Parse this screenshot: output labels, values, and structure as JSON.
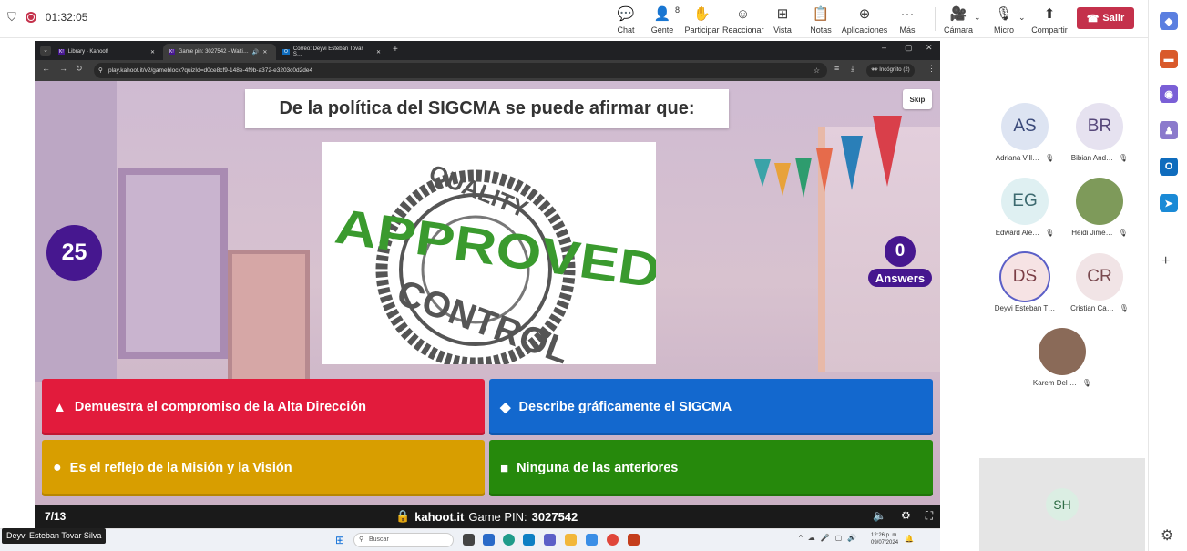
{
  "meeting": {
    "timer": "01:32:05",
    "tools": [
      {
        "label": "Chat",
        "icon": "chat-icon",
        "glyph": "💬"
      },
      {
        "label": "Gente",
        "icon": "people-icon",
        "glyph": "👤",
        "count": "8"
      },
      {
        "label": "Participar",
        "icon": "raise-hand-icon",
        "glyph": "✋"
      },
      {
        "label": "Reaccionar",
        "icon": "react-icon",
        "glyph": "☺"
      },
      {
        "label": "Vista",
        "icon": "view-icon",
        "glyph": "⊞"
      },
      {
        "label": "Notas",
        "icon": "notes-icon",
        "glyph": "📋"
      },
      {
        "label": "Aplicaciones",
        "icon": "apps-icon",
        "glyph": "⊕"
      },
      {
        "label": "Más",
        "icon": "more-icon",
        "glyph": "···"
      }
    ],
    "camera_label": "Cámara",
    "mic_label": "Micro",
    "share_label": "Compartir",
    "leave_label": "Salir"
  },
  "browser": {
    "tabs": [
      "Library - Kahoot!",
      "Game pin: 3027542 - Waiti…",
      "Correo: Deyvi Esteban Tovar S…"
    ],
    "url": "play.kahoot.it/v2/gameblock?quizId=d0ce8cf9-148e-4f9b-a372-e3203c0d2de4",
    "incognito": "Incógnito (2)"
  },
  "game": {
    "question": "De la política del SIGCMA se puede afirmar que:",
    "skip_label": "Skip",
    "timer": "25",
    "answers_count": "0",
    "answers_label": "Answers",
    "image_text_top": "QUALITY",
    "image_text_mid": "APPROVED",
    "image_text_bottom": "CONTROL",
    "choices": [
      {
        "text": "Demuestra el compromiso de la Alta Dirección",
        "shape": "▲"
      },
      {
        "text": "Describe gráficamente el SIGCMA",
        "shape": "◆"
      },
      {
        "text": "Es el reflejo de la Misión y la Visión",
        "shape": "●"
      },
      {
        "text": "Ninguna de las anteriores",
        "shape": "■"
      }
    ],
    "progress": "7/13",
    "site": "kahoot.it",
    "pin_label": "Game PIN:",
    "pin": "3027542"
  },
  "participants": [
    {
      "initials": "AS",
      "name": "Adriana Vill…",
      "bg": "#dde4f2",
      "fg": "#3b4a7a"
    },
    {
      "initials": "BR",
      "name": "Bibian And…",
      "bg": "#e6e2f0",
      "fg": "#56477a"
    },
    {
      "initials": "EG",
      "name": "Edward Ale…",
      "bg": "#dff0f2",
      "fg": "#3d6a70"
    },
    {
      "initials": "",
      "name": "Heidi Jime…",
      "bg": "#7e9a5a",
      "fg": "#fff"
    },
    {
      "initials": "DS",
      "name": "Deyvi Esteban T…",
      "bg": "#f6e3e4",
      "fg": "#7a3d45"
    },
    {
      "initials": "CR",
      "name": "Cristian Ca…",
      "bg": "#f1e4e6",
      "fg": "#7a4a50"
    },
    {
      "initials": "",
      "name": "Karem Del …",
      "bg": "#8a6a58",
      "fg": "#fff"
    }
  ],
  "self_view": {
    "initials": "SH"
  },
  "presenter": "Deyvi Esteban Tovar Silva",
  "taskbar": {
    "search_placeholder": "Buscar",
    "time": "12:26 p. m.",
    "date": "09/07/2024"
  }
}
